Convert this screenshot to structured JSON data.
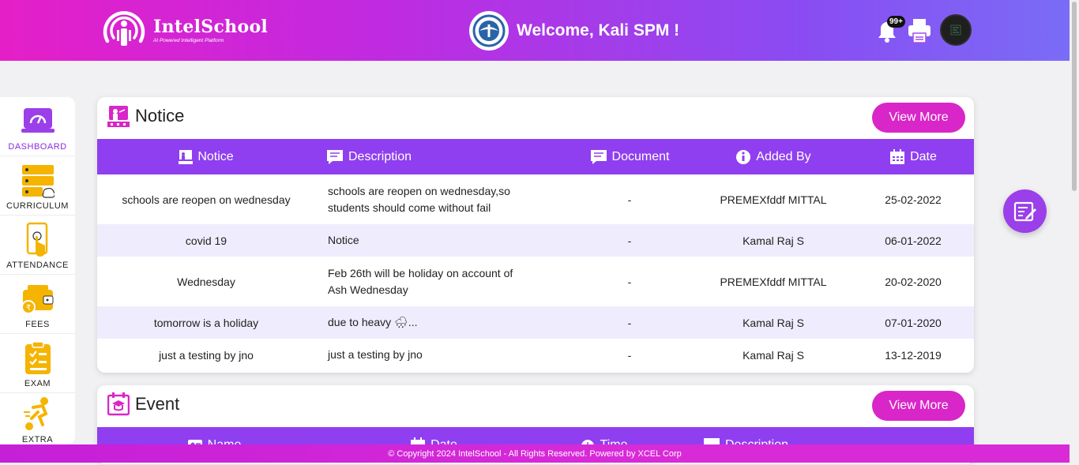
{
  "header": {
    "logo_title": "IntelSchool",
    "logo_subtitle": "AI Powered Intelligent Platform",
    "welcome": "Welcome, Kali SPM !",
    "notification_count": "99+"
  },
  "sidebar": {
    "items": [
      {
        "label": "DASHBOARD",
        "icon": "dashboard-icon",
        "active": true
      },
      {
        "label": "CURRICULUM",
        "icon": "curriculum-icon"
      },
      {
        "label": "ATTENDANCE",
        "icon": "attendance-icon"
      },
      {
        "label": "FEES",
        "icon": "fees-icon"
      },
      {
        "label": "EXAM",
        "icon": "exam-icon"
      },
      {
        "label": "EXTRA CURRICULAR",
        "icon": "extra-curricular-icon"
      }
    ]
  },
  "notice": {
    "title": "Notice",
    "view_more": "View More",
    "columns": [
      "Notice",
      "Description",
      "Document",
      "Added By",
      "Date"
    ],
    "rows": [
      {
        "notice": "schools are reopen on wednesday",
        "description": "schools are reopen on wednesday,so students should come without fail",
        "document": "-",
        "added_by": "PREMEXfddf MITTAL",
        "date": "25-02-2022"
      },
      {
        "notice": "covid 19",
        "description": "Notice",
        "document": "-",
        "added_by": "Kamal Raj S",
        "date": "06-01-2022"
      },
      {
        "notice": "Wednesday",
        "description": "Feb 26th will be holiday on account of Ash Wednesday",
        "document": "-",
        "added_by": "PREMEXfddf MITTAL",
        "date": "20-02-2020"
      },
      {
        "notice": "tomorrow is a holiday",
        "description": "due to heavy 🌧...",
        "document": "-",
        "added_by": "Kamal Raj S",
        "date": "07-01-2020"
      },
      {
        "notice": "just a testing by jno",
        "description": "just a testing by jno",
        "document": "-",
        "added_by": "Kamal Raj S",
        "date": "13-12-2019"
      }
    ]
  },
  "event": {
    "title": "Event",
    "view_more": "View More",
    "columns": [
      "Name",
      "Date",
      "Time",
      "Description"
    ]
  },
  "footer": {
    "text": "© Copyright 2024 IntelSchool - All Rights Reserved. Powered by XCEL Corp"
  },
  "colors": {
    "accent_purple": "#8f3ff0",
    "button_pink": "#d926c8",
    "row_alt": "#efedfd"
  }
}
